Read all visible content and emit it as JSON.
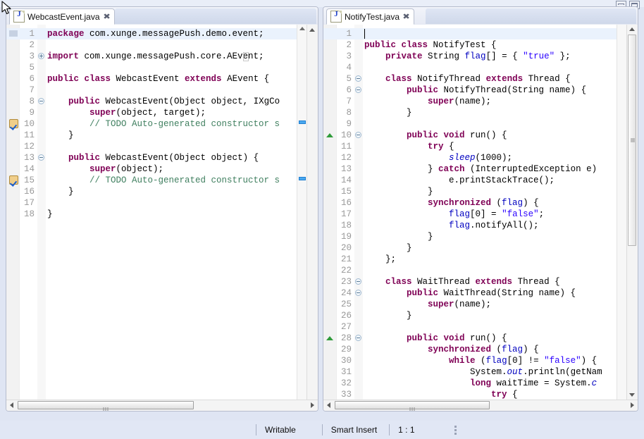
{
  "window": {
    "minimize_label": "minimize",
    "maximize_label": "maximize"
  },
  "editors": [
    {
      "tab": {
        "label": "WebcastEvent.java",
        "close_label": "✖",
        "icon": "java-file-icon"
      },
      "lines": [
        {
          "num": "1",
          "current": true,
          "segments": [
            {
              "t": "package",
              "c": "kw"
            },
            {
              "t": " com.xunge.messagePush.demo.event;",
              "c": "pln"
            }
          ]
        },
        {
          "num": "2",
          "segments": []
        },
        {
          "num": "3",
          "fold": "plus",
          "eolbox": true,
          "segments": [
            {
              "t": "import",
              "c": "kw"
            },
            {
              "t": " com.xunge.messagePush.core.AEvent;",
              "c": "pln"
            }
          ]
        },
        {
          "num": "5",
          "segments": []
        },
        {
          "num": "6",
          "segments": [
            {
              "t": "public class",
              "c": "kw"
            },
            {
              "t": " WebcastEvent ",
              "c": "pln"
            },
            {
              "t": "extends",
              "c": "kw"
            },
            {
              "t": " AEvent {",
              "c": "pln"
            }
          ]
        },
        {
          "num": "7",
          "segments": []
        },
        {
          "num": "8",
          "fold": "minus",
          "segments": [
            {
              "t": "    ",
              "c": "pln"
            },
            {
              "t": "public",
              "c": "kw"
            },
            {
              "t": " WebcastEvent(Object object, IXgCo",
              "c": "pln"
            }
          ]
        },
        {
          "num": "9",
          "segments": [
            {
              "t": "        ",
              "c": "pln"
            },
            {
              "t": "super",
              "c": "kw"
            },
            {
              "t": "(object, target);",
              "c": "pln"
            }
          ]
        },
        {
          "num": "10",
          "todo": true,
          "ruler": true,
          "segments": [
            {
              "t": "        // TODO Auto-generated constructor s",
              "c": "cmt"
            }
          ]
        },
        {
          "num": "11",
          "segments": [
            {
              "t": "    }",
              "c": "pln"
            }
          ]
        },
        {
          "num": "12",
          "segments": []
        },
        {
          "num": "13",
          "fold": "minus",
          "segments": [
            {
              "t": "    ",
              "c": "pln"
            },
            {
              "t": "public",
              "c": "kw"
            },
            {
              "t": " WebcastEvent(Object object) {",
              "c": "pln"
            }
          ]
        },
        {
          "num": "14",
          "segments": [
            {
              "t": "        ",
              "c": "pln"
            },
            {
              "t": "super",
              "c": "kw"
            },
            {
              "t": "(object);",
              "c": "pln"
            }
          ]
        },
        {
          "num": "15",
          "todo": true,
          "ruler": true,
          "segments": [
            {
              "t": "        // TODO Auto-generated constructor s",
              "c": "cmt"
            }
          ]
        },
        {
          "num": "16",
          "segments": [
            {
              "t": "    }",
              "c": "pln"
            }
          ]
        },
        {
          "num": "17",
          "segments": []
        },
        {
          "num": "18",
          "segments": [
            {
              "t": "}",
              "c": "pln"
            }
          ]
        }
      ]
    },
    {
      "tab": {
        "label": "NotifyTest.java",
        "close_label": "✖",
        "icon": "java-file-icon"
      },
      "lines": [
        {
          "num": "1",
          "current": true,
          "caret": true,
          "segments": []
        },
        {
          "num": "2",
          "segments": [
            {
              "t": "public class",
              "c": "kw"
            },
            {
              "t": " NotifyTest {",
              "c": "pln"
            }
          ]
        },
        {
          "num": "3",
          "segments": [
            {
              "t": "    ",
              "c": "pln"
            },
            {
              "t": "private",
              "c": "kw"
            },
            {
              "t": " String ",
              "c": "pln"
            },
            {
              "t": "flag",
              "c": "fld"
            },
            {
              "t": "[] = { ",
              "c": "pln"
            },
            {
              "t": "\"true\"",
              "c": "str"
            },
            {
              "t": " };",
              "c": "pln"
            }
          ]
        },
        {
          "num": "4",
          "segments": []
        },
        {
          "num": "5",
          "fold": "minus",
          "segments": [
            {
              "t": "    ",
              "c": "pln"
            },
            {
              "t": "class",
              "c": "kw"
            },
            {
              "t": " NotifyThread ",
              "c": "pln"
            },
            {
              "t": "extends",
              "c": "kw"
            },
            {
              "t": " Thread {",
              "c": "pln"
            }
          ]
        },
        {
          "num": "6",
          "fold": "minus",
          "segments": [
            {
              "t": "        ",
              "c": "pln"
            },
            {
              "t": "public",
              "c": "kw"
            },
            {
              "t": " NotifyThread(String name) {",
              "c": "pln"
            }
          ]
        },
        {
          "num": "7",
          "segments": [
            {
              "t": "            ",
              "c": "pln"
            },
            {
              "t": "super",
              "c": "kw"
            },
            {
              "t": "(name);",
              "c": "pln"
            }
          ]
        },
        {
          "num": "8",
          "segments": [
            {
              "t": "        }",
              "c": "pln"
            }
          ]
        },
        {
          "num": "9",
          "segments": []
        },
        {
          "num": "10",
          "fold": "minus",
          "arrow": true,
          "ruler_right": true,
          "segments": [
            {
              "t": "        ",
              "c": "pln"
            },
            {
              "t": "public void",
              "c": "kw"
            },
            {
              "t": " run() {",
              "c": "pln"
            }
          ]
        },
        {
          "num": "11",
          "segments": [
            {
              "t": "            ",
              "c": "pln"
            },
            {
              "t": "try",
              "c": "kw"
            },
            {
              "t": " {",
              "c": "pln"
            }
          ]
        },
        {
          "num": "12",
          "segments": [
            {
              "t": "                ",
              "c": "pln"
            },
            {
              "t": "sleep",
              "c": "stc"
            },
            {
              "t": "(1000);",
              "c": "pln"
            }
          ]
        },
        {
          "num": "13",
          "segments": [
            {
              "t": "            } ",
              "c": "pln"
            },
            {
              "t": "catch",
              "c": "kw"
            },
            {
              "t": " (InterruptedException e)",
              "c": "pln"
            }
          ]
        },
        {
          "num": "14",
          "segments": [
            {
              "t": "                e.printStackTrace();",
              "c": "pln"
            }
          ]
        },
        {
          "num": "15",
          "segments": [
            {
              "t": "            }",
              "c": "pln"
            }
          ]
        },
        {
          "num": "16",
          "segments": [
            {
              "t": "            ",
              "c": "pln"
            },
            {
              "t": "synchronized",
              "c": "kw"
            },
            {
              "t": " (",
              "c": "pln"
            },
            {
              "t": "flag",
              "c": "fld"
            },
            {
              "t": ") {",
              "c": "pln"
            }
          ]
        },
        {
          "num": "17",
          "segments": [
            {
              "t": "                ",
              "c": "pln"
            },
            {
              "t": "flag",
              "c": "fld"
            },
            {
              "t": "[0] = ",
              "c": "pln"
            },
            {
              "t": "\"false\"",
              "c": "str"
            },
            {
              "t": ";",
              "c": "pln"
            }
          ]
        },
        {
          "num": "18",
          "segments": [
            {
              "t": "                ",
              "c": "pln"
            },
            {
              "t": "flag",
              "c": "fld"
            },
            {
              "t": ".notifyAll();",
              "c": "pln"
            }
          ]
        },
        {
          "num": "19",
          "segments": [
            {
              "t": "            }",
              "c": "pln"
            }
          ]
        },
        {
          "num": "20",
          "segments": [
            {
              "t": "        }",
              "c": "pln"
            }
          ]
        },
        {
          "num": "21",
          "segments": [
            {
              "t": "    };",
              "c": "pln"
            }
          ]
        },
        {
          "num": "22",
          "segments": []
        },
        {
          "num": "23",
          "fold": "minus",
          "segments": [
            {
              "t": "    ",
              "c": "pln"
            },
            {
              "t": "class",
              "c": "kw"
            },
            {
              "t": " WaitThread ",
              "c": "pln"
            },
            {
              "t": "extends",
              "c": "kw"
            },
            {
              "t": " Thread {",
              "c": "pln"
            }
          ]
        },
        {
          "num": "24",
          "fold": "minus",
          "segments": [
            {
              "t": "        ",
              "c": "pln"
            },
            {
              "t": "public",
              "c": "kw"
            },
            {
              "t": " WaitThread(String name) {",
              "c": "pln"
            }
          ]
        },
        {
          "num": "25",
          "segments": [
            {
              "t": "            ",
              "c": "pln"
            },
            {
              "t": "super",
              "c": "kw"
            },
            {
              "t": "(name);",
              "c": "pln"
            }
          ]
        },
        {
          "num": "26",
          "segments": [
            {
              "t": "        }",
              "c": "pln"
            }
          ]
        },
        {
          "num": "27",
          "segments": []
        },
        {
          "num": "28",
          "fold": "minus",
          "arrow": true,
          "segments": [
            {
              "t": "        ",
              "c": "pln"
            },
            {
              "t": "public void",
              "c": "kw"
            },
            {
              "t": " run() {",
              "c": "pln"
            }
          ]
        },
        {
          "num": "29",
          "segments": [
            {
              "t": "            ",
              "c": "pln"
            },
            {
              "t": "synchronized",
              "c": "kw"
            },
            {
              "t": " (",
              "c": "pln"
            },
            {
              "t": "flag",
              "c": "fld"
            },
            {
              "t": ") {",
              "c": "pln"
            }
          ]
        },
        {
          "num": "30",
          "segments": [
            {
              "t": "                ",
              "c": "pln"
            },
            {
              "t": "while",
              "c": "kw"
            },
            {
              "t": " (",
              "c": "pln"
            },
            {
              "t": "flag",
              "c": "fld"
            },
            {
              "t": "[0] != ",
              "c": "pln"
            },
            {
              "t": "\"false\"",
              "c": "str"
            },
            {
              "t": ") {",
              "c": "pln"
            }
          ]
        },
        {
          "num": "31",
          "segments": [
            {
              "t": "                    System.",
              "c": "pln"
            },
            {
              "t": "out",
              "c": "stc"
            },
            {
              "t": ".println(getNam",
              "c": "pln"
            }
          ]
        },
        {
          "num": "32",
          "segments": [
            {
              "t": "                    ",
              "c": "pln"
            },
            {
              "t": "long",
              "c": "kw"
            },
            {
              "t": " waitTime = System.",
              "c": "pln"
            },
            {
              "t": "c",
              "c": "stc"
            }
          ]
        },
        {
          "num": "33",
          "segments": [
            {
              "t": "                        ",
              "c": "pln"
            },
            {
              "t": "try",
              "c": "kw"
            },
            {
              "t": " {",
              "c": "pln"
            }
          ]
        }
      ]
    }
  ],
  "statusbar": {
    "writable": "Writable",
    "insert_mode": "Smart Insert",
    "position": "1 : 1"
  },
  "colors": {
    "keyword": "#7F0055",
    "string": "#2A00FF",
    "comment": "#3F7F5F",
    "field": "#0000C0",
    "current_line": "#EAF2FD",
    "marker_blue": "#4AA8EF",
    "arrow_green": "#2F9B3A"
  }
}
